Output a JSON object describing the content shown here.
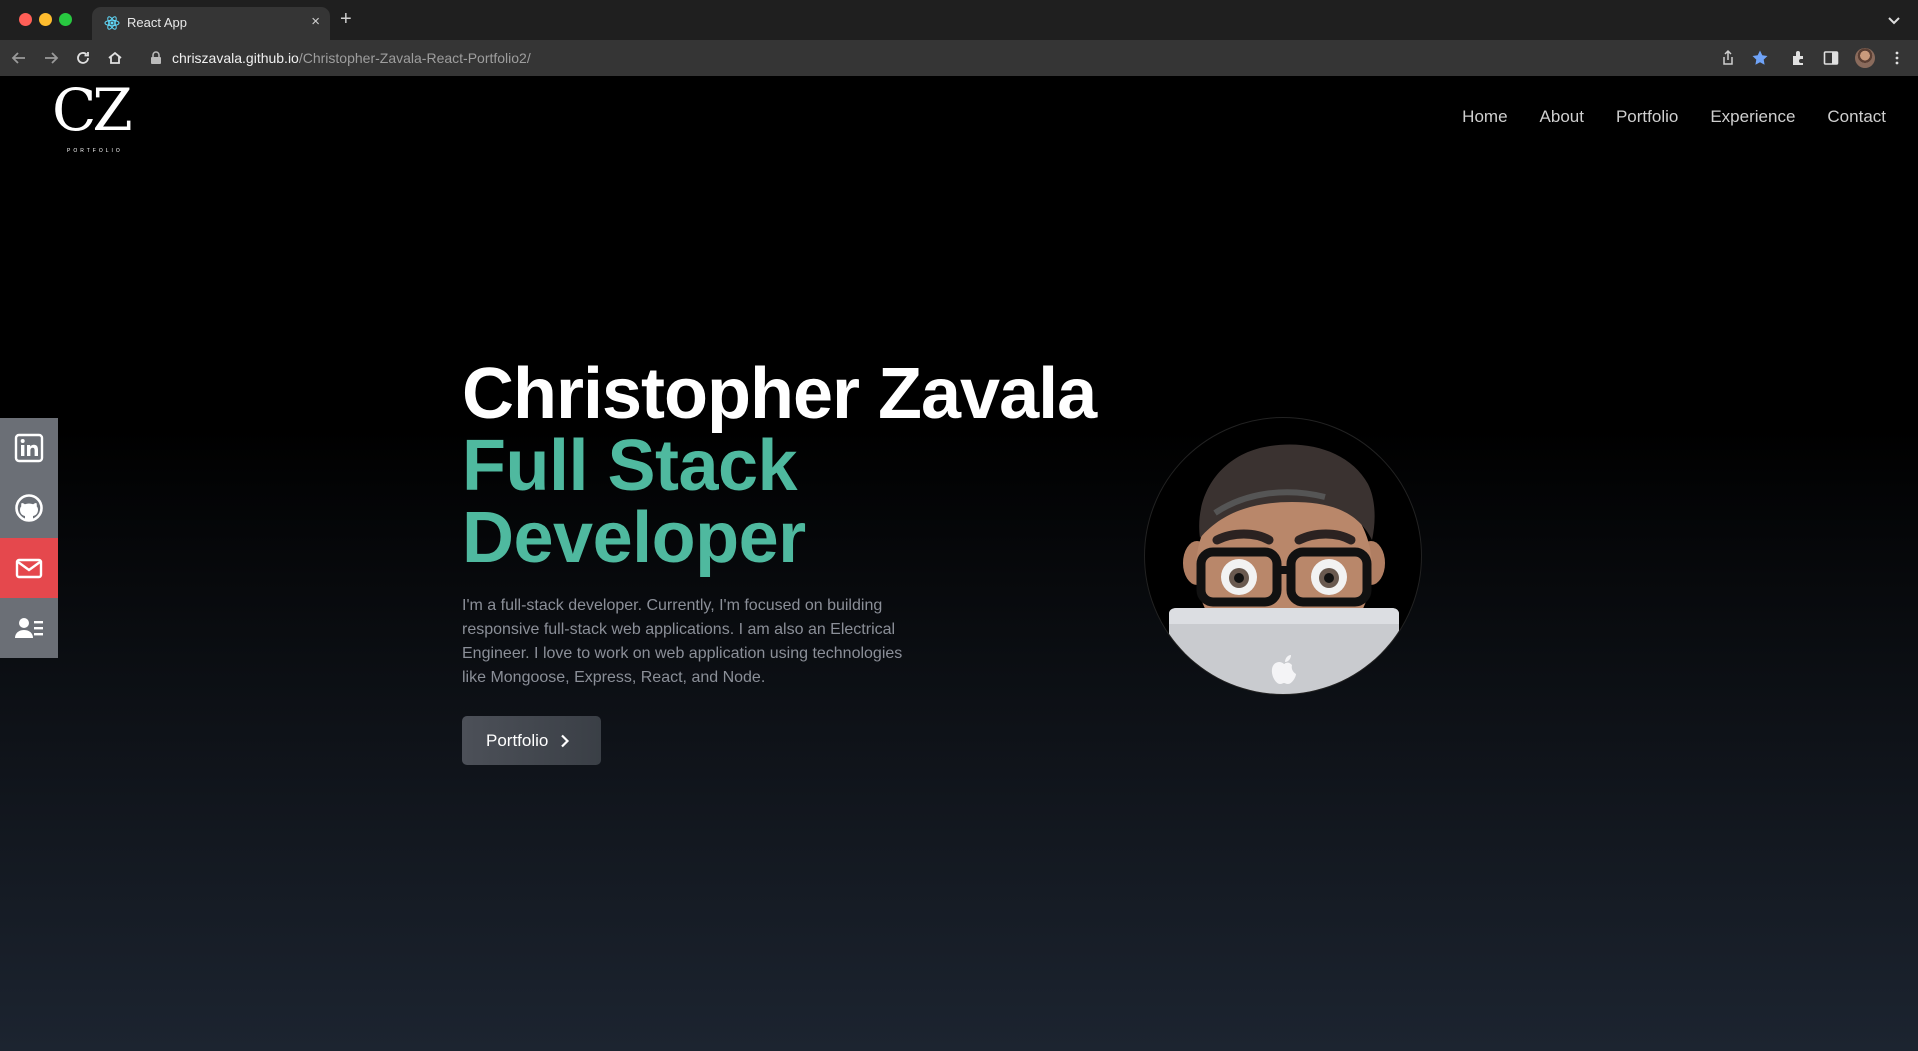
{
  "browser": {
    "tab_title": "React App",
    "tab_close": "×",
    "new_tab": "+",
    "url_host": "chriszavala.github.io",
    "url_path": "/Christopher-Zavala-React-Portfolio2/"
  },
  "site": {
    "logo_mark": "CZ",
    "logo_sub": "PORTFOLIO",
    "nav": [
      "Home",
      "About",
      "Portfolio",
      "Experience",
      "Contact"
    ],
    "social": [
      {
        "icon": "linkedin-icon"
      },
      {
        "icon": "github-icon"
      },
      {
        "icon": "mail-icon"
      },
      {
        "icon": "resume-icon"
      }
    ]
  },
  "hero": {
    "name": "Christopher Zavala",
    "role": "Full Stack Developer",
    "description": "I'm a full-stack developer. Currently, I'm focused on building responsive full-stack web applications. I am also an Electrical Engineer. I love to work on web application using technologies like Mongoose, Express, React, and Node.",
    "button_label": "Portfolio"
  },
  "colors": {
    "accent": "#4fb99f",
    "mail": "#e5484d",
    "social_bg": "#6b6f76"
  }
}
